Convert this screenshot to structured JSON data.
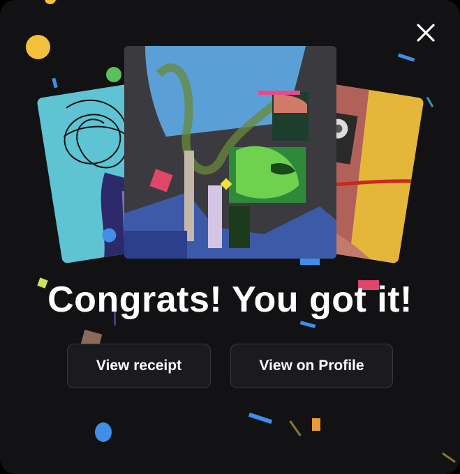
{
  "dialog": {
    "headline": "Congrats! You got it!",
    "close_icon": "close-icon"
  },
  "actions": {
    "view_receipt_label": "View receipt",
    "view_profile_label": "View on Profile"
  },
  "colors": {
    "background": "#121215",
    "button_bg": "#1b1b1f",
    "button_border": "#38383d",
    "text": "#ffffff"
  }
}
